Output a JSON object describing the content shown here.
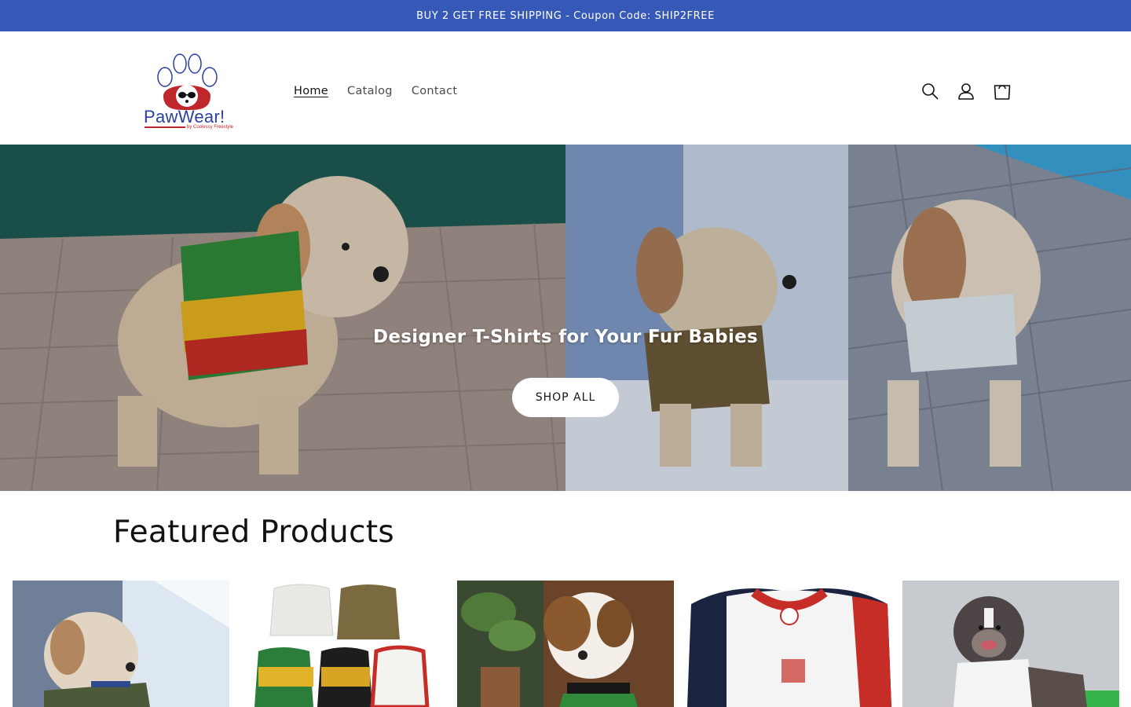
{
  "announcement": {
    "text": "BUY 2 GET FREE SHIPPING - Coupon Code: SHIP2FREE"
  },
  "brand": {
    "name": "PawWear!",
    "tagline": "by Coolessy Freestyle"
  },
  "nav": {
    "items": [
      {
        "label": "Home",
        "active": true
      },
      {
        "label": "Catalog",
        "active": false
      },
      {
        "label": "Contact",
        "active": false
      }
    ]
  },
  "header_icons": [
    "search-icon",
    "account-icon",
    "cart-icon"
  ],
  "hero": {
    "heading": "Designer T-Shirts for Your Fur Babies",
    "button_label": "SHOP ALL"
  },
  "featured": {
    "title": "Featured Products",
    "products": [
      {
        "image": "dog-in-mesh-shirt-on-lounge-chair"
      },
      {
        "image": "assorted-mesh-shirts"
      },
      {
        "image": "terrier-in-rasta-mesh-shirt"
      },
      {
        "image": "red-white-blue-mesh-shirt"
      },
      {
        "image": "pitbull-in-white-mesh-shirt"
      }
    ]
  },
  "colors": {
    "announcement_bg": "#3658b6",
    "text": "#121212",
    "brand_blue": "#2a3f9e",
    "brand_red": "#c0272d"
  }
}
